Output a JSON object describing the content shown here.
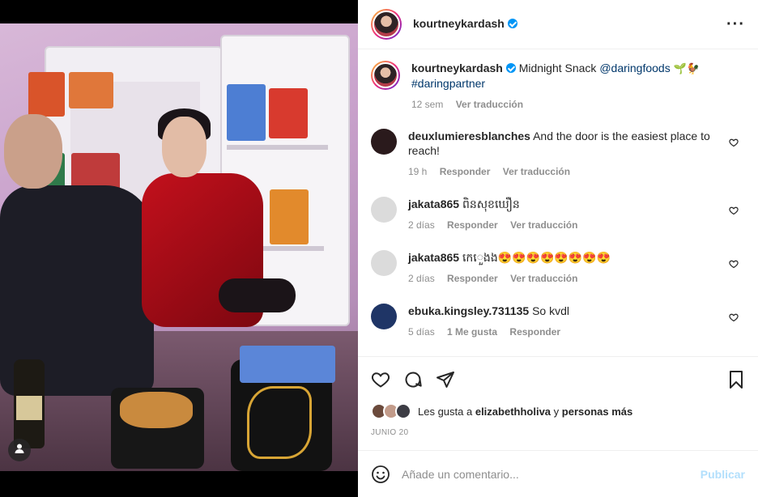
{
  "post": {
    "author": "kourtneykardash",
    "verified": true,
    "caption": {
      "text": "Midnight Snack",
      "mention": "@daringfoods",
      "emojis": "🌱🐓",
      "hashtag": "#daringpartner",
      "time": "12 sem",
      "translate": "Ver traducción"
    }
  },
  "comments": [
    {
      "user": "deuxlumieresblanches",
      "text": "And the door is the easiest place to reach!",
      "time": "19 h",
      "reply": "Responder",
      "translate": "Ver traducción",
      "avatar_color": "#2a1a1c"
    },
    {
      "user": "jakata865",
      "text": "ពិនសុខឃឿន",
      "time": "2 días",
      "reply": "Responder",
      "translate": "Ver traducción",
      "avatar_color": "#dbdbdb"
    },
    {
      "user": "jakata865",
      "text": "កេ​​េួ​ងង😍😍😍😍😍😍😍😍",
      "time": "2 días",
      "reply": "Responder",
      "translate": "Ver traducción",
      "avatar_color": "#dbdbdb"
    },
    {
      "user": "ebuka.kingsley.731135",
      "text": "So kvdl",
      "time": "5 días",
      "likes": "1 Me gusta",
      "reply": "Responder",
      "avatar_color": "#1f3566"
    }
  ],
  "likes": {
    "prefix": "Les gusta a",
    "user": "elizabethholiva",
    "connector": "y",
    "others": "personas más"
  },
  "date": "JUNIO 20",
  "comment_box": {
    "placeholder": "Añade un comentario...",
    "submit": "Publicar"
  },
  "icons": {
    "more": "more-horizontal-icon",
    "like": "heart-icon",
    "comment": "comment-bubble-icon",
    "share": "paper-plane-icon",
    "save": "bookmark-icon",
    "emoji": "smiley-icon",
    "tag": "user-tag-icon"
  },
  "colors": {
    "link": "#00376b",
    "verified": "#0095f6",
    "secondary_text": "#8e8e8e",
    "publish_disabled": "#b2dffc"
  }
}
